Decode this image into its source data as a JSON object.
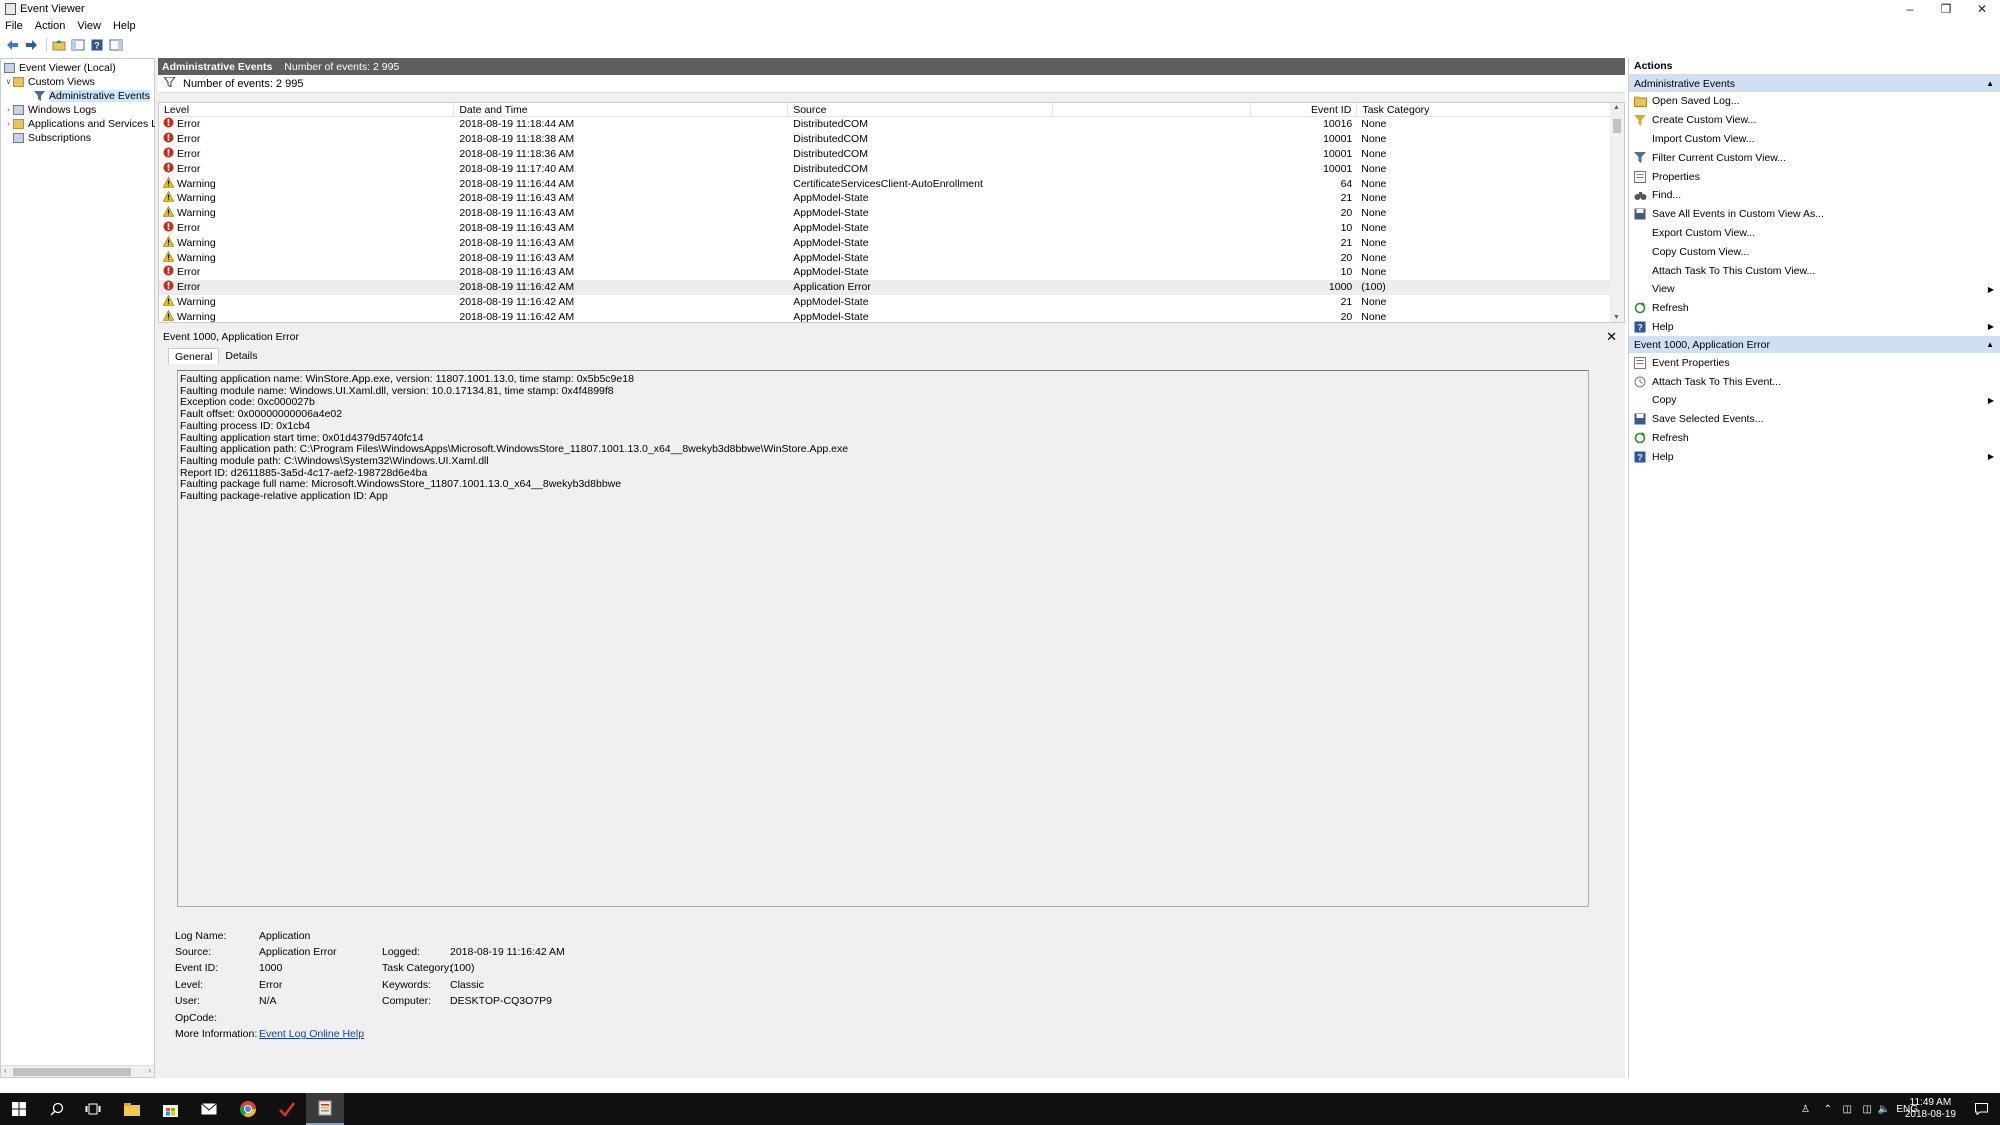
{
  "window": {
    "title": "Event Viewer"
  },
  "menu": [
    "File",
    "Action",
    "View",
    "Help"
  ],
  "tree": {
    "root": "Event Viewer (Local)",
    "custom_views": "Custom Views",
    "administrative_events": "Administrative Events",
    "windows_logs": "Windows Logs",
    "apps_services": "Applications and Services Lo",
    "subscriptions": "Subscriptions"
  },
  "middle": {
    "header_title": "Administrative Events",
    "header_count": "Number of events: 2 995",
    "filter_count": "Number of events: 2 995",
    "columns": [
      "Level",
      "Date and Time",
      "Source",
      "Event ID",
      "Task Category"
    ],
    "events": [
      {
        "level": "Error",
        "date": "2018-08-19 11:18:44 AM",
        "source": "DistributedCOM",
        "id": "10016",
        "task": "None"
      },
      {
        "level": "Error",
        "date": "2018-08-19 11:18:38 AM",
        "source": "DistributedCOM",
        "id": "10001",
        "task": "None"
      },
      {
        "level": "Error",
        "date": "2018-08-19 11:18:36 AM",
        "source": "DistributedCOM",
        "id": "10001",
        "task": "None"
      },
      {
        "level": "Error",
        "date": "2018-08-19 11:17:40 AM",
        "source": "DistributedCOM",
        "id": "10001",
        "task": "None"
      },
      {
        "level": "Warning",
        "date": "2018-08-19 11:16:44 AM",
        "source": "CertificateServicesClient-AutoEnrollment",
        "id": "64",
        "task": "None"
      },
      {
        "level": "Warning",
        "date": "2018-08-19 11:16:43 AM",
        "source": "AppModel-State",
        "id": "21",
        "task": "None"
      },
      {
        "level": "Warning",
        "date": "2018-08-19 11:16:43 AM",
        "source": "AppModel-State",
        "id": "20",
        "task": "None"
      },
      {
        "level": "Error",
        "date": "2018-08-19 11:16:43 AM",
        "source": "AppModel-State",
        "id": "10",
        "task": "None"
      },
      {
        "level": "Warning",
        "date": "2018-08-19 11:16:43 AM",
        "source": "AppModel-State",
        "id": "21",
        "task": "None"
      },
      {
        "level": "Warning",
        "date": "2018-08-19 11:16:43 AM",
        "source": "AppModel-State",
        "id": "20",
        "task": "None"
      },
      {
        "level": "Error",
        "date": "2018-08-19 11:16:43 AM",
        "source": "AppModel-State",
        "id": "10",
        "task": "None"
      },
      {
        "level": "Error",
        "date": "2018-08-19 11:16:42 AM",
        "source": "Application Error",
        "id": "1000",
        "task": "(100)"
      },
      {
        "level": "Warning",
        "date": "2018-08-19 11:16:42 AM",
        "source": "AppModel-State",
        "id": "21",
        "task": "None"
      },
      {
        "level": "Warning",
        "date": "2018-08-19 11:16:42 AM",
        "source": "AppModel-State",
        "id": "20",
        "task": "None"
      }
    ]
  },
  "detail": {
    "title": "Event 1000, Application Error",
    "tabs": [
      "General",
      "Details"
    ],
    "description": [
      "Faulting application name: WinStore.App.exe, version: 11807.1001.13.0, time stamp: 0x5b5c9e18",
      "Faulting module name: Windows.UI.Xaml.dll, version: 10.0.17134.81, time stamp: 0x4f4899f8",
      "Exception code: 0xc000027b",
      "Fault offset: 0x00000000006a4e02",
      "Faulting process ID: 0x1cb4",
      "Faulting application start time: 0x01d4379d5740fc14",
      "Faulting application path: C:\\Program Files\\WindowsApps\\Microsoft.WindowsStore_11807.1001.13.0_x64__8wekyb3d8bbwe\\WinStore.App.exe",
      "Faulting module path: C:\\Windows\\System32\\Windows.UI.Xaml.dll",
      "Report ID: d2611885-3a5d-4c17-aef2-198728d6e4ba",
      "Faulting package full name: Microsoft.WindowsStore_11807.1001.13.0_x64__8wekyb3d8bbwe",
      "Faulting package-relative application ID: App"
    ],
    "props": {
      "log_name_label": "Log Name:",
      "log_name": "Application",
      "source_label": "Source:",
      "source": "Application Error",
      "logged_label": "Logged:",
      "logged": "2018-08-19 11:16:42 AM",
      "event_id_label": "Event ID:",
      "event_id": "1000",
      "task_label": "Task Category:",
      "task": "(100)",
      "level_label": "Level:",
      "level": "Error",
      "keywords_label": "Keywords:",
      "keywords": "Classic",
      "user_label": "User:",
      "user": "N/A",
      "computer_label": "Computer:",
      "computer": "DESKTOP-CQ3O7P9",
      "opcode_label": "OpCode:",
      "more_info_label": "More Information:",
      "more_info_link": "Event Log Online Help"
    }
  },
  "actions": {
    "header": "Actions",
    "section1": "Administrative Events",
    "items1": [
      {
        "label": "Open Saved Log...",
        "icon": "open-folder-icon"
      },
      {
        "label": "Create Custom View...",
        "icon": "funnel-icon"
      },
      {
        "label": "Import Custom View...",
        "icon": ""
      },
      {
        "label": "Filter Current Custom View...",
        "icon": "filter-icon"
      },
      {
        "label": "Properties",
        "icon": "properties-icon"
      },
      {
        "label": "Find...",
        "icon": "binoculars-icon"
      },
      {
        "label": "Save All Events in Custom View As...",
        "icon": "save-icon"
      },
      {
        "label": "Export Custom View...",
        "icon": ""
      },
      {
        "label": "Copy Custom View...",
        "icon": ""
      },
      {
        "label": "Attach Task To This Custom View...",
        "icon": ""
      },
      {
        "label": "View",
        "icon": "",
        "submenu": true
      },
      {
        "label": "Refresh",
        "icon": "refresh-icon"
      },
      {
        "label": "Help",
        "icon": "help-icon",
        "submenu": true
      }
    ],
    "section2": "Event 1000, Application Error",
    "items2": [
      {
        "label": "Event Properties",
        "icon": "properties-icon"
      },
      {
        "label": "Attach Task To This Event...",
        "icon": "task-icon"
      },
      {
        "label": "Copy",
        "icon": "copy-icon",
        "submenu": true
      },
      {
        "label": "Save Selected Events...",
        "icon": "save-icon"
      },
      {
        "label": "Refresh",
        "icon": "refresh-icon"
      },
      {
        "label": "Help",
        "icon": "help-icon",
        "submenu": true
      }
    ]
  },
  "taskbar": {
    "lang": "ENG",
    "time": "11:49 AM",
    "date": "2018-08-19"
  },
  "colors": {
    "header_bg": "#5e5e5e",
    "section_bg": "#cfe0f4",
    "error_red": "#c42b1c",
    "warning_yellow": "#f2c200",
    "link": "#1a3fa7"
  }
}
